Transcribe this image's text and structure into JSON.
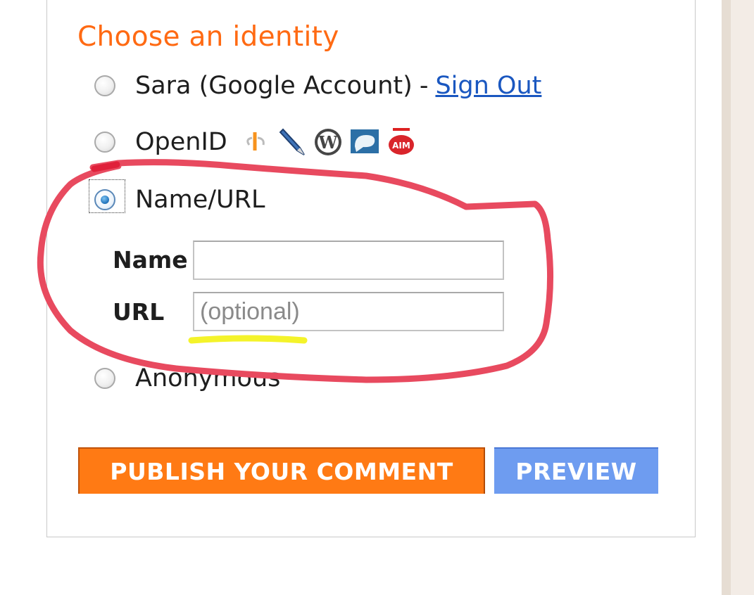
{
  "identity": {
    "heading": "Choose an identity",
    "options": [
      {
        "label": "Sara (Google Account)",
        "separator": "-",
        "link": "Sign Out",
        "selected": false
      },
      {
        "label": "OpenID",
        "selected": false,
        "icons": [
          "openid-icon",
          "livejournal-pencil-icon",
          "wordpress-icon",
          "typepad-speech-icon",
          "aim-icon"
        ]
      },
      {
        "label": "Name/URL",
        "selected": true
      },
      {
        "label": "Anonymous",
        "selected": false
      }
    ]
  },
  "form": {
    "name_label": "Name",
    "name_value": "",
    "url_label": "URL",
    "url_placeholder": "(optional)"
  },
  "buttons": {
    "publish": "PUBLISH YOUR COMMENT",
    "preview": "PREVIEW"
  },
  "colors": {
    "heading": "#ff6a13",
    "publish_bg": "#ff7a14",
    "preview_bg": "#6e9cf0",
    "link": "#1a57c0",
    "annotation_circle": "#e84a5f",
    "annotation_underline": "#f4f32a"
  }
}
